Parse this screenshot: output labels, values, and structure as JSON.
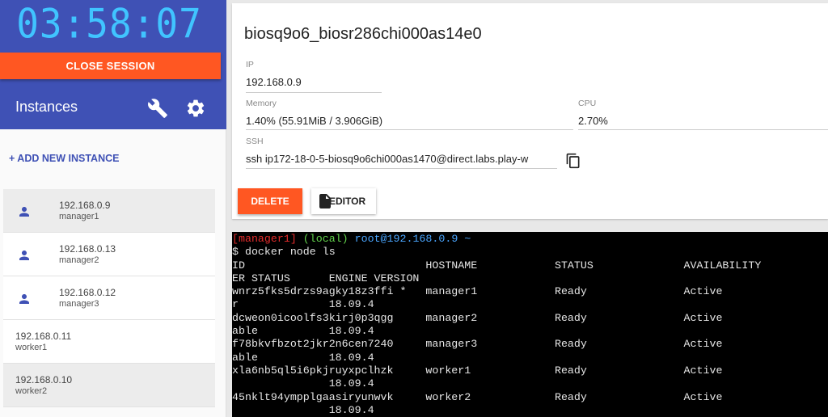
{
  "sidebar": {
    "timer": "03:58:07",
    "close_session_label": "CLOSE SESSION",
    "title": "Instances",
    "add_instance_label": "+ ADD NEW INSTANCE",
    "instances": [
      {
        "ip": "192.168.0.9",
        "name": "manager1",
        "role_icon": "person-icon",
        "selected": true
      },
      {
        "ip": "192.168.0.13",
        "name": "manager2",
        "role_icon": "person-icon",
        "selected": false
      },
      {
        "ip": "192.168.0.12",
        "name": "manager3",
        "role_icon": "person-icon",
        "selected": false
      },
      {
        "ip": "192.168.0.11",
        "name": "worker1",
        "role_icon": "",
        "selected": false
      },
      {
        "ip": "192.168.0.10",
        "name": "worker2",
        "role_icon": "",
        "selected": false
      }
    ]
  },
  "details": {
    "title": "biosq9o6_biosr286chi000as14e0",
    "ip_label": "IP",
    "ip_value": "192.168.0.9",
    "memory_label": "Memory",
    "memory_value": "1.40% (55.91MiB / 3.906GiB)",
    "cpu_label": "CPU",
    "cpu_value": "2.70%",
    "ssh_label": "SSH",
    "ssh_value": "ssh ip172-18-0-5-biosq9o6chi000as1470@direct.labs.play-w",
    "delete_label": "DELETE",
    "editor_label": "EDITOR"
  },
  "terminal": {
    "prompt_user": "[manager1]",
    "prompt_local": "(local)",
    "prompt_host": "root@192.168.0.9 ~",
    "lines": [
      "$ docker node ls",
      "ID                            HOSTNAME            STATUS              AVAILABILITY",
      "ER STATUS      ENGINE VERSION",
      "wnrz5fks5drzs9agky18z3ffi *   manager1            Ready               Active",
      "r              18.09.4",
      "dcweon0icoolfs3kirj0p3qgg     manager2            Ready               Active",
      "able           18.09.4",
      "f78bkvfbzot2jkr2n6cen7240     manager3            Ready               Active",
      "able           18.09.4",
      "xla6nb5ql5i6pkjruyxpclhzk     worker1             Ready               Active",
      "               18.09.4",
      "45nklt94ympplgaasiryunwvk     worker2             Ready               Active",
      "               18.09.4"
    ]
  },
  "colors": {
    "sidebar_header": "#3f51b5",
    "timer": "#40c4ff",
    "accent_button": "#ff5722",
    "link": "#3f51b5"
  }
}
